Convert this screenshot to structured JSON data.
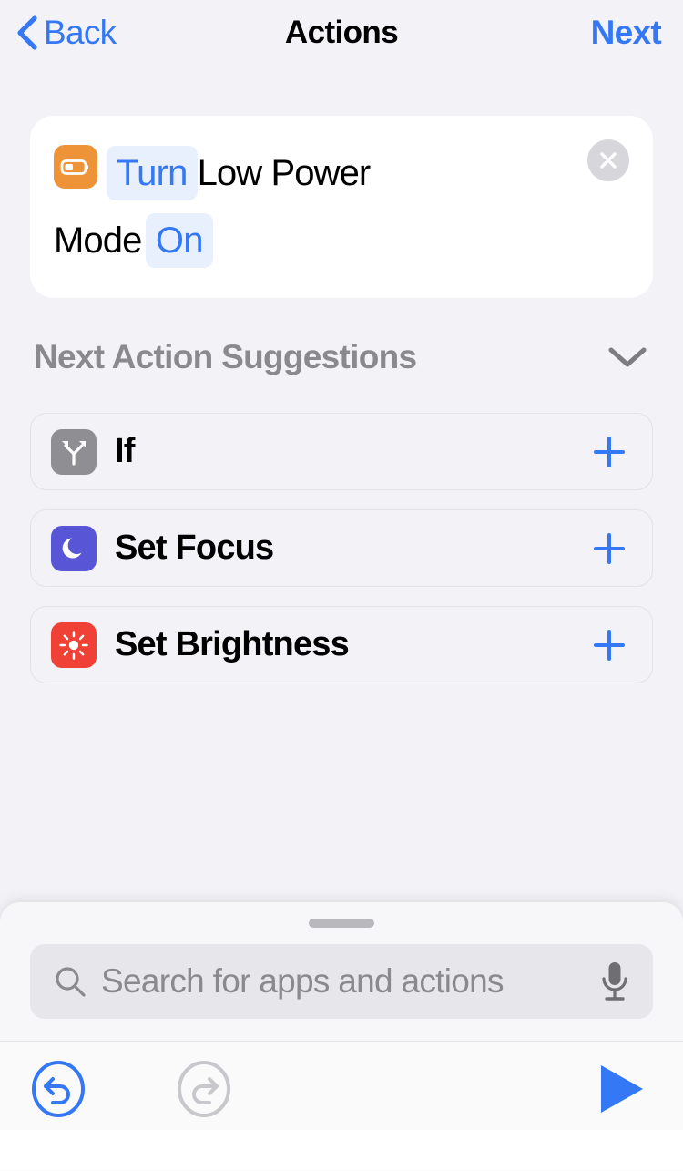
{
  "nav": {
    "back_label": "Back",
    "title": "Actions",
    "next_label": "Next",
    "back_icon": "chevron-left-icon",
    "accent_color": "#3478f6"
  },
  "action_card": {
    "app_icon": "low-power-battery-icon",
    "app_icon_color": "#ef9338",
    "tokens": [
      {
        "type": "pill",
        "text": "Turn"
      },
      {
        "type": "text",
        "text": "Low Power"
      },
      {
        "type": "text",
        "text": "Mode"
      },
      {
        "type": "pill",
        "text": "On"
      }
    ],
    "verb": "Turn",
    "subject_line1": "Low Power",
    "subject_line2": "Mode",
    "value": "On",
    "remove_icon": "close-circle-icon",
    "pill_bg": "#e8f0fe",
    "pill_fg": "#3478f6"
  },
  "suggestions": {
    "header_label": "Next Action Suggestions",
    "collapse_icon": "chevron-down-icon",
    "items": [
      {
        "label": "If",
        "icon": "branch-fork-icon",
        "icon_color": "#8e8e93",
        "add_icon": "plus-icon"
      },
      {
        "label": "Set Focus",
        "icon": "moon-icon",
        "icon_color": "#5856d6",
        "add_icon": "plus-icon"
      },
      {
        "label": "Set Brightness",
        "icon": "sun-brightness-icon",
        "icon_color": "#ef4136",
        "add_icon": "plus-icon"
      }
    ]
  },
  "sheet": {
    "grabber": "sheet-grabber",
    "search": {
      "placeholder": "Search for apps and actions",
      "value": "",
      "search_icon": "search-icon",
      "mic_icon": "microphone-icon"
    }
  },
  "toolbar": {
    "undo": {
      "icon": "undo-icon",
      "enabled": true,
      "color": "#3478f6"
    },
    "redo": {
      "icon": "redo-icon",
      "enabled": false,
      "color": "#c7c7cc"
    },
    "play": {
      "icon": "play-icon",
      "color": "#3478f6"
    }
  }
}
